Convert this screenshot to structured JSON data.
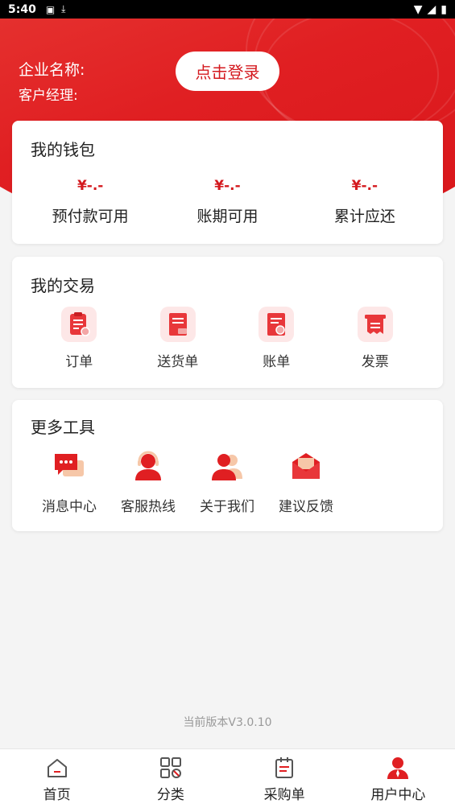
{
  "status_bar": {
    "time": "5:40"
  },
  "header": {
    "company_label": "企业名称:",
    "manager_label": "客户经理:",
    "login_button": "点击登录"
  },
  "wallet": {
    "title": "我的钱包",
    "items": [
      {
        "amount": "¥-.-",
        "label": "预付款可用"
      },
      {
        "amount": "¥-.-",
        "label": "账期可用"
      },
      {
        "amount": "¥-.-",
        "label": "累计应还"
      }
    ]
  },
  "trade": {
    "title": "我的交易",
    "items": [
      {
        "label": "订单",
        "icon": "order-icon"
      },
      {
        "label": "送货单",
        "icon": "delivery-note-icon"
      },
      {
        "label": "账单",
        "icon": "bill-icon"
      },
      {
        "label": "发票",
        "icon": "invoice-icon"
      }
    ]
  },
  "tools": {
    "title": "更多工具",
    "items": [
      {
        "label": "消息中心",
        "icon": "message-icon"
      },
      {
        "label": "客服热线",
        "icon": "customer-service-icon"
      },
      {
        "label": "关于我们",
        "icon": "about-us-icon"
      },
      {
        "label": "建议反馈",
        "icon": "feedback-icon"
      }
    ]
  },
  "version": "当前版本V3.0.10",
  "tabbar": {
    "items": [
      {
        "label": "首页",
        "icon": "home-icon"
      },
      {
        "label": "分类",
        "icon": "category-icon"
      },
      {
        "label": "采购单",
        "icon": "purchase-list-icon"
      },
      {
        "label": "用户中心",
        "icon": "user-center-icon"
      }
    ]
  },
  "colors": {
    "primary": "#e01f22",
    "background": "#f4f4f4",
    "icon_bg": "#fde7e7"
  }
}
